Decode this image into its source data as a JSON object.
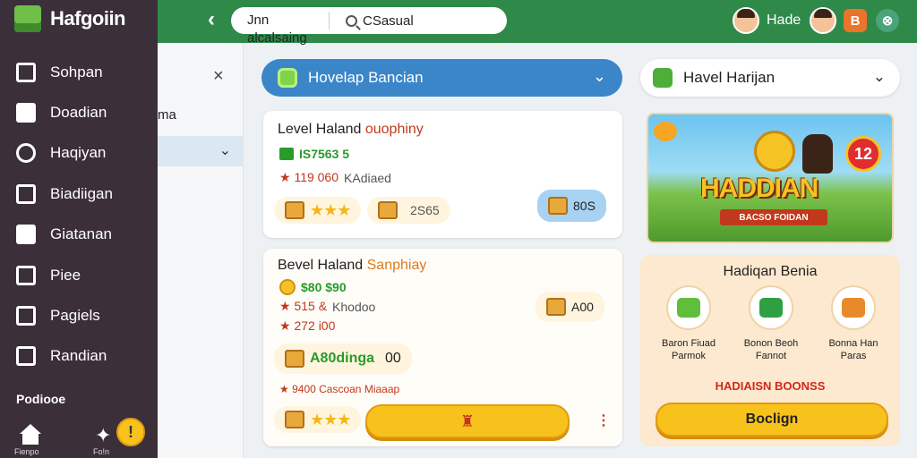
{
  "app": {
    "brand": "Hafgoiin",
    "nav": [
      {
        "label": "Sohpan",
        "icon": "cube-icon"
      },
      {
        "label": "Doadian",
        "icon": "chest-icon"
      },
      {
        "label": "Haqiyan",
        "icon": "rocket-icon"
      },
      {
        "label": "Biadiigan",
        "icon": "calendar-icon"
      },
      {
        "label": "Giatanan",
        "icon": "house-icon"
      },
      {
        "label": "Piee",
        "icon": "grid-icon"
      },
      {
        "label": "Pagiels",
        "icon": "picture-icon"
      },
      {
        "label": "Randian",
        "icon": "frame-icon"
      }
    ],
    "footer_title": "Podiooe",
    "bottom": {
      "home_label": "Fienpo",
      "star_label": "Fo!n",
      "badge": "!"
    }
  },
  "header": {
    "back": "‹",
    "search_left": "Jnn alcalsaing",
    "search_right": "CSasual",
    "user_name": "Hade",
    "btn_orange": "B",
    "btn_teal": "⊗"
  },
  "panel2": {
    "close": "×",
    "text": "ma",
    "chev": "⌄"
  },
  "main": {
    "dropdown": {
      "label": "Hovelap Bancian",
      "chev": "⌄"
    },
    "card1": {
      "title_a": "Level Haland ",
      "title_b": "ouophiny",
      "price": "IS7563 5",
      "line2_red": "★ 119 060",
      "line2_grey": "KAdiaed",
      "pill_value": "2S65",
      "blue_pill_value": "80S"
    },
    "card2": {
      "title_a": "Bevel Haland ",
      "title_b": "Sanphiay",
      "price": "$80 $90",
      "line2_red": "★ 515 &",
      "line2_grey": "Khodoo",
      "line3_red": "★ 272 i00",
      "right_pill_value": "A00",
      "pill_label": "A80dinga",
      "pill_value": "00",
      "line4": "★ 9400 Cascoan Miaaap"
    }
  },
  "right": {
    "dropdown": {
      "label": "Havel Harijan",
      "chev": "⌄"
    },
    "banner": {
      "title": "HADDIAN",
      "ribbon": "BACSO FOIDAN",
      "badge": "12"
    },
    "bonus": {
      "title": "Hadiqan Benia",
      "items": [
        {
          "label": "Baron Fiuad Parmok",
          "color": "#5fbf3a"
        },
        {
          "label": "Bonon Beoh Fannot",
          "color": "#2fa042"
        },
        {
          "label": "Bonna Han Paras",
          "color": "#e98a2a"
        }
      ],
      "red_text": "HADIAISN BOONSS",
      "button": "Boclign"
    }
  }
}
